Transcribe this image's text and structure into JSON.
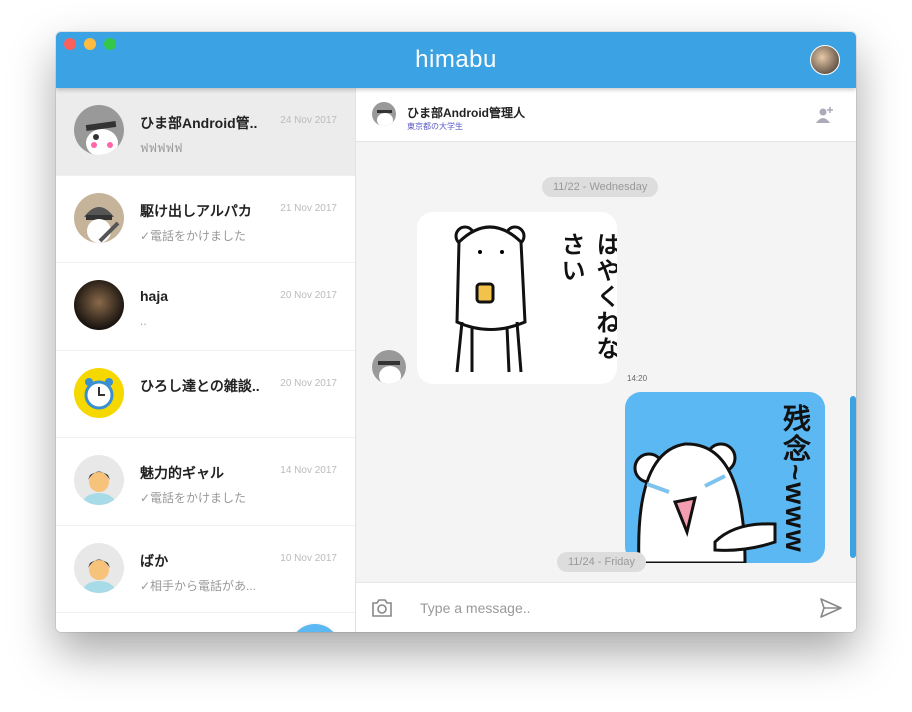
{
  "app": {
    "title": "himabu",
    "accent": "#3ba3e3"
  },
  "conversations": [
    {
      "name": "ひま部Android管..",
      "date": "24 Nov 2017",
      "preview": "ฟฟฟฟฟ",
      "active": true
    },
    {
      "name": "駆け出しアルパカ",
      "date": "21 Nov 2017",
      "preview": "✓電話をかけました"
    },
    {
      "name": "haja",
      "date": "20 Nov 2017",
      "preview": ".."
    },
    {
      "name": "ひろし達との雑談..",
      "date": "20 Nov 2017",
      "preview": ""
    },
    {
      "name": "魅力的ギャル",
      "date": "14 Nov 2017",
      "preview": "✓電話をかけました"
    },
    {
      "name": "ばか",
      "date": "10 Nov 2017",
      "preview": "✓相手から電話があ..."
    }
  ],
  "chat": {
    "header": {
      "name": "ひま部Android管理人",
      "subtitle": "東京都の大学生"
    },
    "dates": [
      "11/22 - Wednesday",
      "11/24 - Friday"
    ],
    "messages": [
      {
        "from": "other",
        "type": "sticker",
        "sticker_text": "はやくねなさい"
      },
      {
        "from": "me",
        "type": "sticker",
        "time": "14:20",
        "sticker_text": "残念~www"
      }
    ],
    "input": {
      "placeholder": "Type a message..",
      "value": ""
    }
  }
}
